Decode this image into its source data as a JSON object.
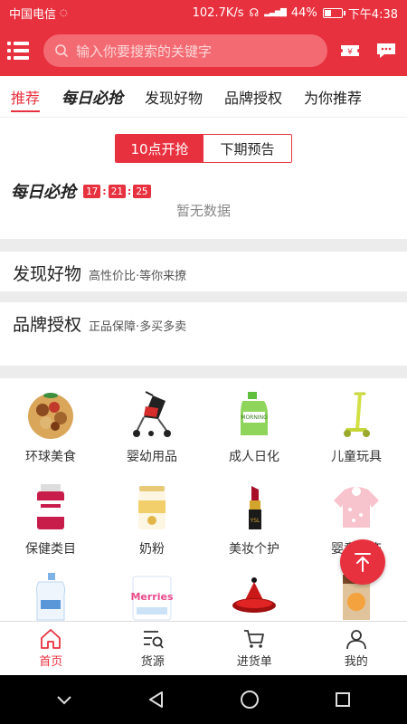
{
  "status_bar": {
    "carrier": "中国电信",
    "net_speed": "102.7K/s",
    "battery": "44%",
    "battery_level": 0.44,
    "time": "下午4:38"
  },
  "header": {
    "search_placeholder": "输入你要搜索的关键字",
    "left_icon": "menu-icon",
    "right_icons": [
      "coupon-icon",
      "message-icon"
    ]
  },
  "tabs": [
    {
      "label": "推荐",
      "active": true
    },
    {
      "label": "每日必抢",
      "active": false
    },
    {
      "label": "发现好物",
      "active": false
    },
    {
      "label": "品牌授权",
      "active": false
    },
    {
      "label": "为你推荐",
      "active": false
    }
  ],
  "switch": {
    "on_label": "10点开抢",
    "off_label": "下期预告"
  },
  "daily": {
    "title": "每日必抢",
    "countdown": [
      "17",
      "21",
      "25"
    ],
    "empty_text": "暂无数据"
  },
  "discover": {
    "title": "发现好物",
    "subtitle": "高性价比·等你来撩"
  },
  "brand": {
    "title": "品牌授权",
    "subtitle": "正品保障·多买多卖"
  },
  "categories": [
    {
      "label": "环球美食",
      "icon": "food-icon"
    },
    {
      "label": "婴幼用品",
      "icon": "stroller-icon"
    },
    {
      "label": "成人日化",
      "icon": "detergent-icon"
    },
    {
      "label": "儿童玩具",
      "icon": "scooter-icon"
    },
    {
      "label": "保健类目",
      "icon": "supplement-icon"
    },
    {
      "label": "奶粉",
      "icon": "milk-powder-icon"
    },
    {
      "label": "美妆个护",
      "icon": "lipstick-icon"
    },
    {
      "label": "婴童服饰",
      "icon": "baby-clothes-icon"
    },
    {
      "label": "",
      "icon": "lotion-icon"
    },
    {
      "label": "",
      "icon": "diaper-icon"
    },
    {
      "label": "",
      "icon": "cookware-icon"
    },
    {
      "label": "",
      "icon": "cereal-icon"
    }
  ],
  "bottom_nav": [
    {
      "label": "首页",
      "icon": "home-icon",
      "active": true
    },
    {
      "label": "货源",
      "icon": "source-list-icon",
      "active": false
    },
    {
      "label": "进货单",
      "icon": "cart-icon",
      "active": false
    },
    {
      "label": "我的",
      "icon": "user-icon",
      "active": false
    }
  ],
  "colors": {
    "accent": "#e8313f",
    "divider": "#ececec"
  }
}
